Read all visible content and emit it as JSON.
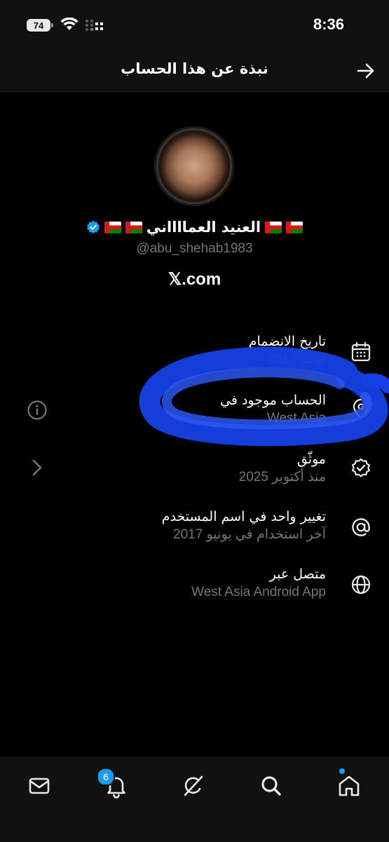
{
  "status_bar": {
    "battery": "74",
    "time": "8:36"
  },
  "header": {
    "title": "نبذة عن هذا الحساب"
  },
  "profile": {
    "display_name": "العنيد العمااااني",
    "handle": "@abu_shehab1983",
    "site": "𝕏.com"
  },
  "info": {
    "joined": {
      "label": "تاريخ الانضمام",
      "value": "يونيو 2017",
      "icon": "calendar-icon"
    },
    "location": {
      "label": "الحساب موجود في",
      "value": "West Asia",
      "icon": "location-icon"
    },
    "verified": {
      "label": "موثّق",
      "value": "منذ أكتوبر 2025",
      "icon": "verified-badge-icon"
    },
    "username_changes": {
      "label": "تغيير واحد في اسم المستخدم",
      "value": "آخر استخدام في يونيو 2017",
      "icon": "at-sign-icon"
    },
    "connected_via": {
      "label": "متصل عبر",
      "value": "West Asia Android App",
      "icon": "globe-icon"
    }
  },
  "bottom_nav": {
    "notifications_badge": "6",
    "items": [
      "messages",
      "notifications",
      "grok",
      "search",
      "home"
    ]
  },
  "colors": {
    "accent": "#1d9bf0",
    "secondary_text": "#71767b",
    "scribble": "#1540e6"
  }
}
